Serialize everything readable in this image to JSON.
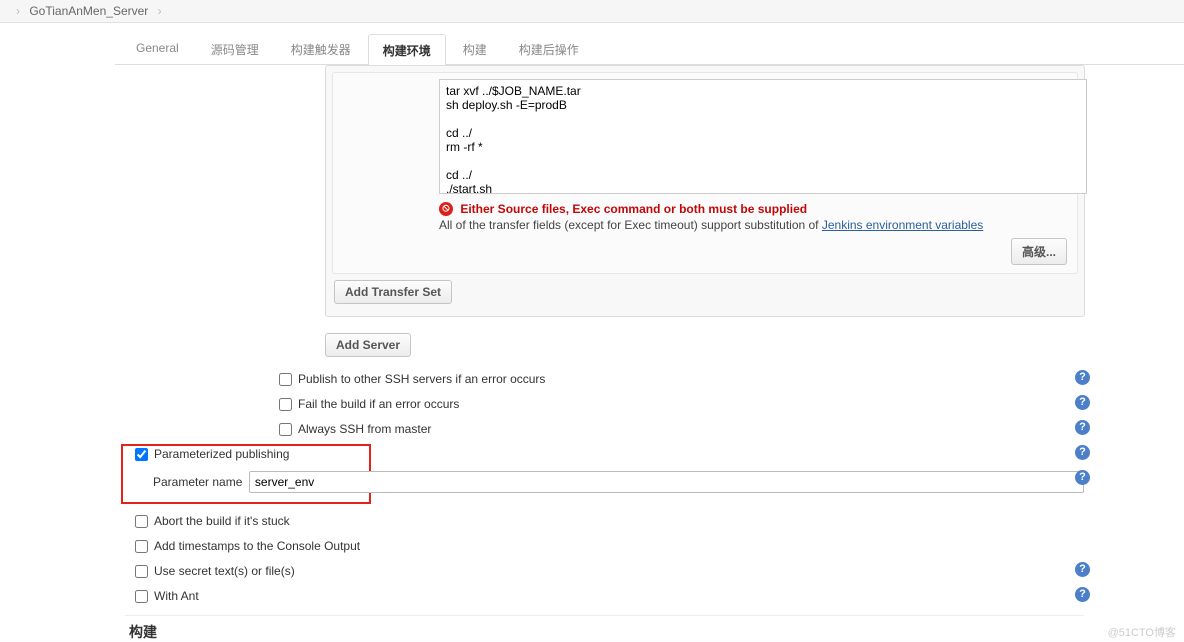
{
  "breadcrumb": {
    "project": "GoTianAnMen_Server"
  },
  "tabs": {
    "general": "General",
    "scm": "源码管理",
    "triggers": "构建触发器",
    "env": "构建环境",
    "build": "构建",
    "post": "构建后操作"
  },
  "exec_command": "tar xvf ../$JOB_NAME.tar\nsh deploy.sh -E=prodB\n\ncd ../\nrm -rf *\n\ncd ../\n./start.sh",
  "error_msg": "Either Source files, Exec command or both must be supplied",
  "hint_prefix": "All of the transfer fields (except for Exec timeout) support substitution of ",
  "hint_link": "Jenkins environment variables",
  "buttons": {
    "advanced": "高级...",
    "add_transfer": "Add Transfer Set",
    "add_server": "Add Server"
  },
  "ssh_opts": {
    "other_servers": "Publish to other SSH servers if an error occurs",
    "fail_build": "Fail the build if an error occurs",
    "always_master": "Always SSH from master"
  },
  "param_pub": {
    "label": "Parameterized publishing",
    "param_name_label": "Parameter name",
    "param_name_value": "server_env"
  },
  "lower_opts": {
    "abort": "Abort the build if it's stuck",
    "timestamps": "Add timestamps to the Console Output",
    "secret": "Use secret text(s) or file(s)",
    "ant": "With Ant"
  },
  "build_heading": "构建",
  "watermark": "@51CTO博客"
}
